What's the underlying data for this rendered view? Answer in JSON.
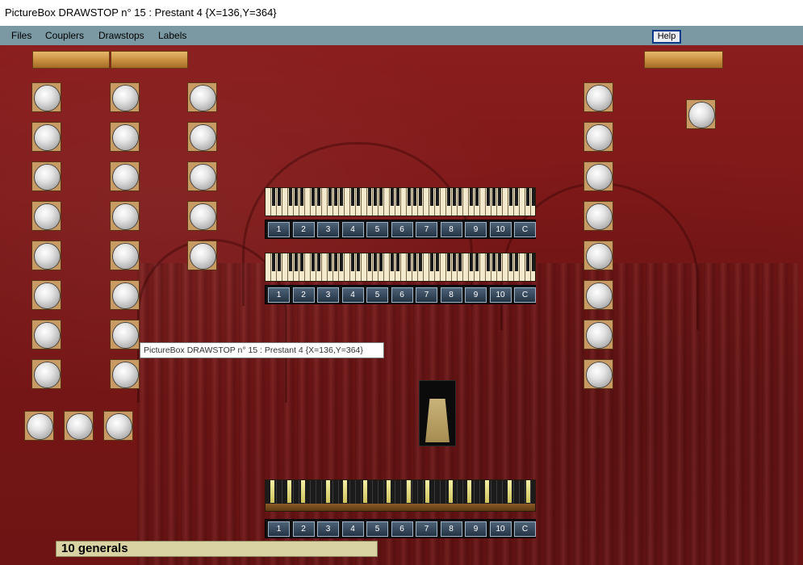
{
  "window": {
    "title": "PictureBox DRAWSTOP n° 15 : Prestant 4  {X=136,Y=364}"
  },
  "menu": {
    "files": "Files",
    "couplers": "Couplers",
    "drawstops": "Drawstops",
    "labels": "Labels",
    "help": "Help"
  },
  "tooltip": "PictureBox DRAWSTOP n° 15 : Prestant 4  {X=136,Y=364}",
  "pistons": {
    "labels": [
      "1",
      "2",
      "3",
      "4",
      "5",
      "6",
      "7",
      "8",
      "9",
      "10",
      "C"
    ]
  },
  "status": {
    "text": "10 generals"
  },
  "colors": {
    "background": "#7a1818",
    "menubar": "#7a99a3",
    "status": "#d9d2a2"
  }
}
